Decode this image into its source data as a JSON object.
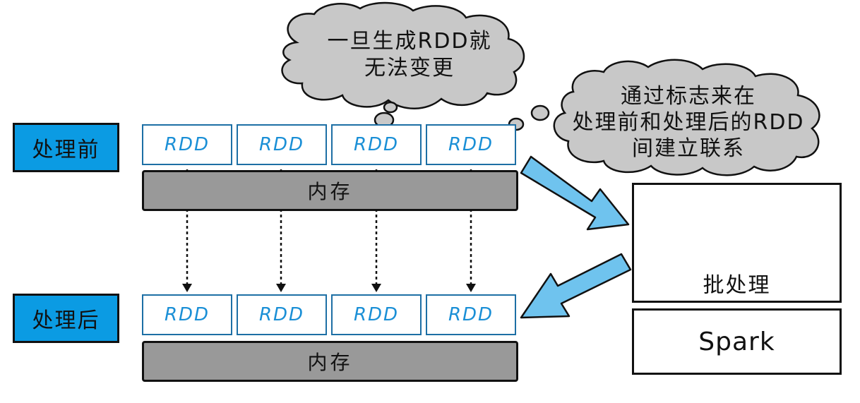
{
  "labels": {
    "before": "处理前",
    "after": "处理后"
  },
  "rdd_label": "RDD",
  "rdd_before": [
    "RDD",
    "RDD",
    "RDD",
    "RDD"
  ],
  "rdd_after": [
    "RDD",
    "RDD",
    "RDD",
    "RDD"
  ],
  "memory_label": "内存",
  "cloud_left": {
    "line1": "一旦生成RDD就",
    "line2": "无法变更"
  },
  "cloud_right": {
    "line1": "通过标志来在",
    "line2": "处理前和处理后的RDD",
    "line3": "间建立联系"
  },
  "batch_label": "批处理",
  "spark_label": "Spark",
  "colors": {
    "label_blue": "#0b9be3",
    "rdd_text": "#1a8fd6",
    "rdd_border": "#1d6fa5",
    "memory_gray": "#999999",
    "cloud_gray": "#c8c8c8",
    "arrow_blue": "#6fc3ee"
  }
}
